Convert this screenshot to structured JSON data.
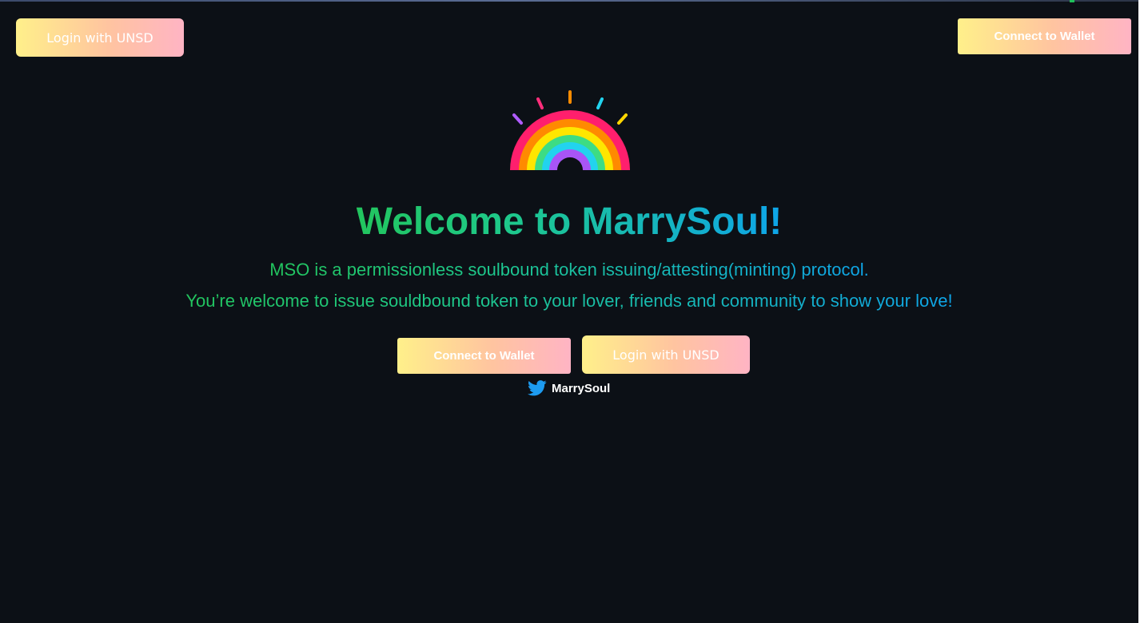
{
  "header": {
    "login_button": "Login with UNSD",
    "wallet_button": "Connect to Wallet"
  },
  "hero": {
    "logo_icon": "rainbow-icon",
    "title": "Welcome to MarrySoul!",
    "description_line1": "MSO is a permissionless soulbound token issuing/attesting(minting) protocol.",
    "description_line2": "You’re welcome to issue souldbound token to your lover, friends and community to show your love!",
    "wallet_button": "Connect to Wallet",
    "login_button": "Login with UNSD"
  },
  "social": {
    "icon": "twitter-icon",
    "label": "MarrySoul"
  },
  "colors": {
    "background": "#0c1016",
    "button_gradient_start": "#fff08a",
    "button_gradient_end": "#ffb4c4",
    "text_gradient_start": "#22c55e",
    "text_gradient_end": "#0ea5e9",
    "twitter_blue": "#1d9bf0"
  }
}
